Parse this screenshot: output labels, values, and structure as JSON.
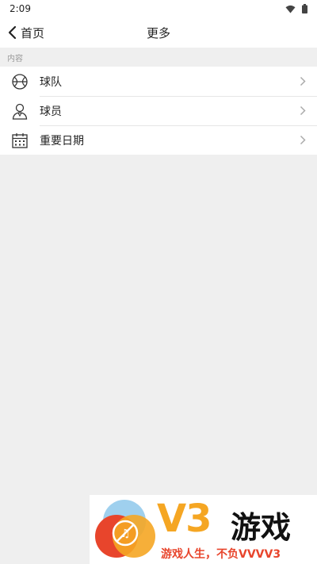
{
  "status_bar": {
    "time": "2:09"
  },
  "nav": {
    "back_label": "首页",
    "title": "更多"
  },
  "section": {
    "header": "内容"
  },
  "menu": {
    "items": [
      {
        "label": "球队",
        "icon": "basketball-icon"
      },
      {
        "label": "球员",
        "icon": "player-icon"
      },
      {
        "label": "重要日期",
        "icon": "calendar-icon"
      }
    ]
  },
  "watermark": {
    "brand": "V3",
    "brand_suffix": "游戏",
    "slogan": "游戏人生，不负VVVV3"
  }
}
